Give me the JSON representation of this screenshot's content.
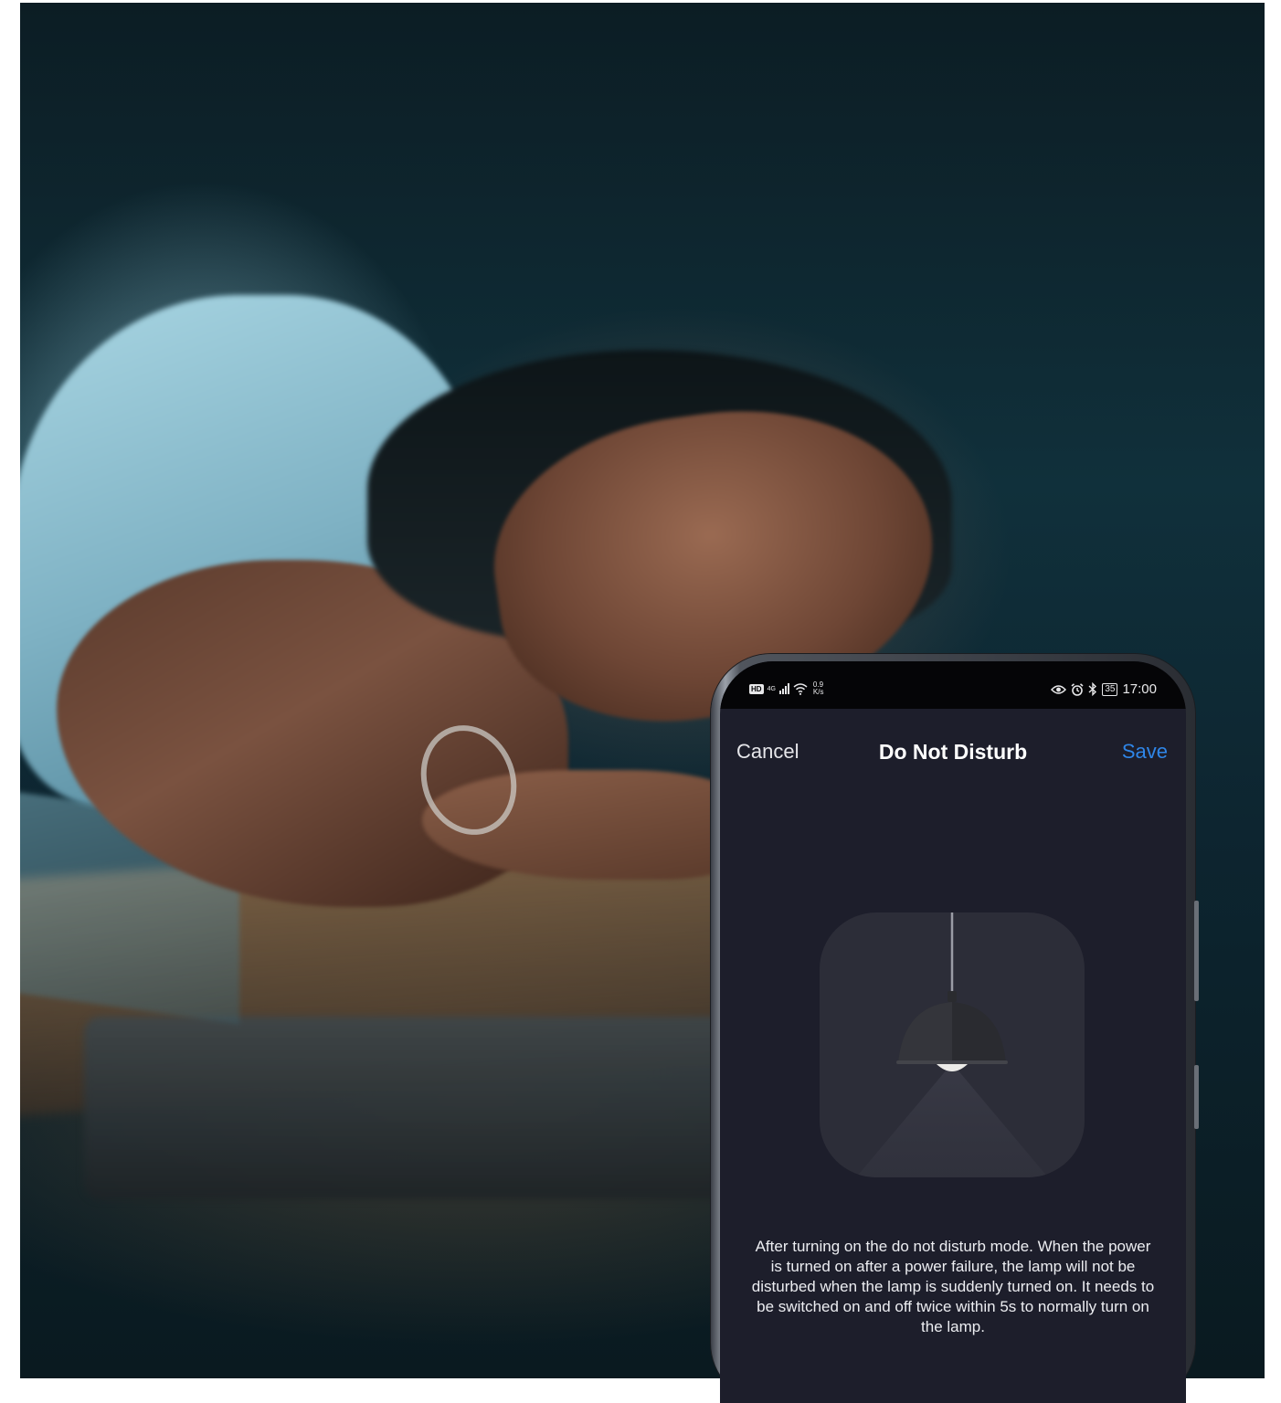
{
  "status_bar": {
    "hd_label": "HD",
    "network_label": "4G",
    "speed_value": "0.9",
    "speed_unit": "K/s",
    "battery_level": "35",
    "time": "17:00"
  },
  "header": {
    "cancel_label": "Cancel",
    "title": "Do Not Disturb",
    "save_label": "Save"
  },
  "description": "After turning on the do not disturb mode. When the power is turned on after a power failure, the lamp will not be disturbed when the lamp is suddenly turned on. It needs to be switched on and off twice within 5s to normally turn on the lamp.",
  "colors": {
    "screen_background": "#1d1e2b",
    "accent": "#2f86e8",
    "illustration_tile": "#2c2d38"
  },
  "icons": [
    "hd-icon",
    "signal-icon",
    "wifi-icon",
    "eye-icon",
    "alarm-icon",
    "bluetooth-icon",
    "battery-icon",
    "pendant-lamp-icon"
  ]
}
